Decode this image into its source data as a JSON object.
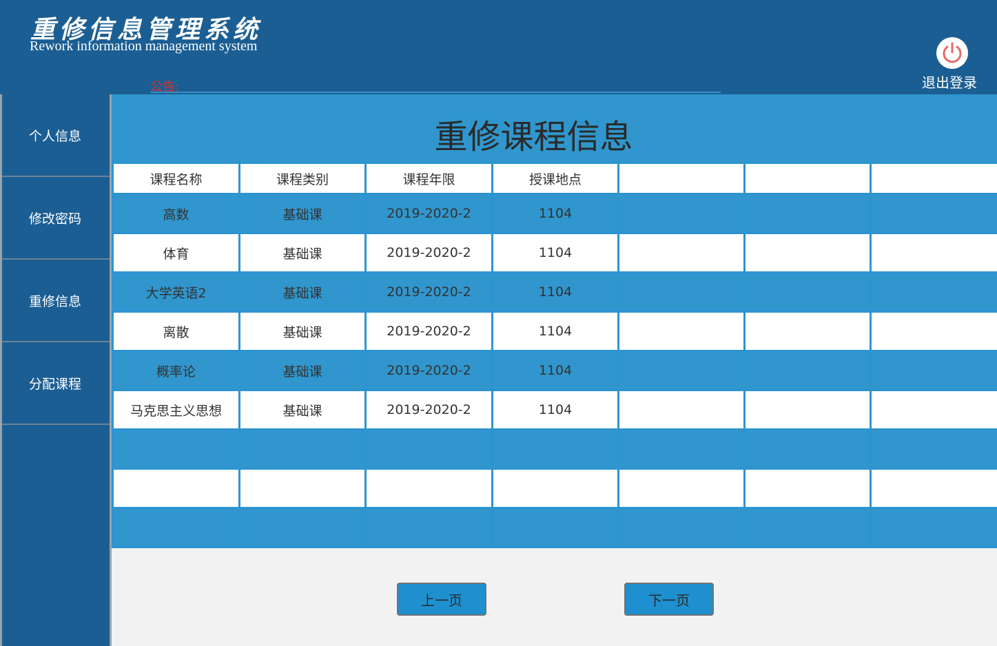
{
  "header": {
    "title": "重修信息管理系统",
    "subtitle": "Rework information management system",
    "notice_label": "公告:",
    "logout_label": "退出登录"
  },
  "sidebar": {
    "items": [
      {
        "label": "个人信息"
      },
      {
        "label": "修改密码"
      },
      {
        "label": "重修信息"
      },
      {
        "label": "分配课程"
      }
    ]
  },
  "main": {
    "title": "重修课程信息",
    "table": {
      "headers": [
        "课程名称",
        "课程类别",
        "课程年限",
        "授课地点",
        "",
        "",
        ""
      ],
      "rows": [
        [
          "高数",
          "基础课",
          "2019-2020-2",
          "1104",
          "",
          "",
          ""
        ],
        [
          "体育",
          "基础课",
          "2019-2020-2",
          "1104",
          "",
          "",
          ""
        ],
        [
          "大学英语2",
          "基础课",
          "2019-2020-2",
          "1104",
          "",
          "",
          ""
        ],
        [
          "离散",
          "基础课",
          "2019-2020-2",
          "1104",
          "",
          "",
          ""
        ],
        [
          "概率论",
          "基础课",
          "2019-2020-2",
          "1104",
          "",
          "",
          ""
        ],
        [
          "马克思主义思想",
          "基础课",
          "2019-2020-2",
          "1104",
          "",
          "",
          ""
        ],
        [
          "",
          "",
          "",
          "",
          "",
          "",
          ""
        ],
        [
          "",
          "",
          "",
          "",
          "",
          "",
          ""
        ],
        [
          "",
          "",
          "",
          "",
          "",
          "",
          ""
        ]
      ]
    },
    "pager": {
      "prev_label": "上一页",
      "next_label": "下一页"
    }
  },
  "colors": {
    "header_bg": "#1b5e93",
    "accent_blue": "#3096cd",
    "notice_red": "#e0302a"
  },
  "icons": {
    "logout": "power-icon"
  }
}
